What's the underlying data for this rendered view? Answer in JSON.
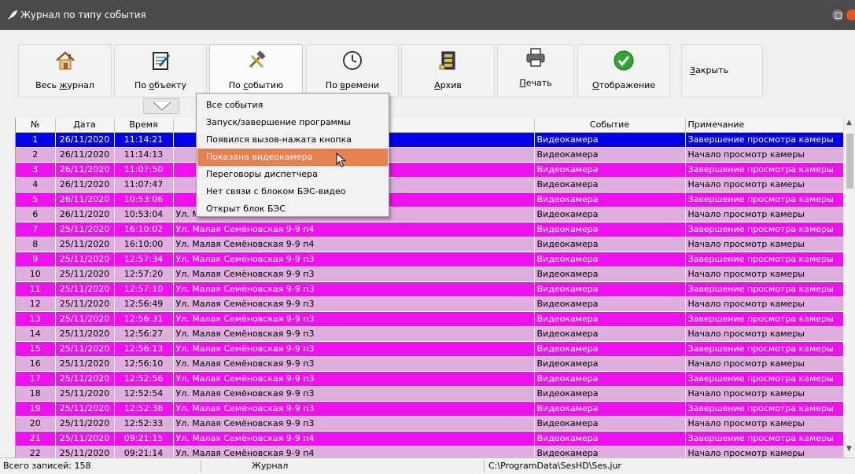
{
  "window": {
    "title": "Журнал по типу события"
  },
  "toolbar": {
    "buttons": [
      {
        "label": "Весь журнал",
        "icon": "house-icon"
      },
      {
        "label": "По объекту",
        "icon": "notepad-pencil-icon"
      },
      {
        "label": "По событию",
        "icon": "hammer-tools-icon"
      },
      {
        "label": "По времени",
        "icon": "clock-icon"
      },
      {
        "label": "Архив",
        "icon": "archive-cabinet-icon"
      },
      {
        "label": "Печать",
        "icon": "printer-icon"
      },
      {
        "label": "Отображение",
        "icon": "check-icon"
      },
      {
        "label": "Закрыть",
        "icon": ""
      }
    ]
  },
  "menu": {
    "items": [
      "Все события",
      "Запуск/завершение программы",
      "Появился вызов-нажата кнопка",
      "Показана видеокамера",
      "Переговоры диспетчера",
      "Нет связи с блоком БЭС-видео",
      "Открыт блок БЭС"
    ],
    "active_index": 3
  },
  "table": {
    "columns": [
      "№",
      "Дата",
      "Время",
      "",
      "Событие",
      "Примечание"
    ],
    "rows": [
      [
        "1",
        "26/11/2020",
        "11:14:21",
        "",
        "Видеокамера",
        "Завершение просмотра камеры"
      ],
      [
        "2",
        "26/11/2020",
        "11:14:13",
        "",
        "Видеокамера",
        "Начало просмотр камеры"
      ],
      [
        "3",
        "26/11/2020",
        "11:07:50",
        "",
        "Видеокамера",
        "Завершение просмотра камеры"
      ],
      [
        "4",
        "26/11/2020",
        "11:07:47",
        "",
        "Видеокамера",
        "Начало просмотр камеры"
      ],
      [
        "5",
        "26/11/2020",
        "10:53:06",
        "",
        "Видеокамера",
        "Завершение просмотра камеры"
      ],
      [
        "6",
        "26/11/2020",
        "10:53:04",
        "Ул. Малая Семёновская 9-9 п4",
        "Видеокамера",
        "Начало просмотр камеры"
      ],
      [
        "7",
        "25/11/2020",
        "16:10:02",
        "Ул. Малая Семёновская 9-9 п4",
        "Видеокамера",
        "Завершение просмотра камеры"
      ],
      [
        "8",
        "25/11/2020",
        "16:10:00",
        "Ул. Малая Семёновская 9-9 п4",
        "Видеокамера",
        "Начало просмотр камеры"
      ],
      [
        "9",
        "25/11/2020",
        "12:57:34",
        "Ул. Малая Семёновская 9-9 п3",
        "Видеокамера",
        "Завершение просмотра камеры"
      ],
      [
        "10",
        "25/11/2020",
        "12:57:20",
        "Ул. Малая Семёновская 9-9 п3",
        "Видеокамера",
        "Начало просмотр камеры"
      ],
      [
        "11",
        "25/11/2020",
        "12:57:10",
        "Ул. Малая Семёновская 9-9 п3",
        "Видеокамера",
        "Завершение просмотра камеры"
      ],
      [
        "12",
        "25/11/2020",
        "12:56:49",
        "Ул. Малая Семёновская 9-9 п3",
        "Видеокамера",
        "Начало просмотр камеры"
      ],
      [
        "13",
        "25/11/2020",
        "12:56:31",
        "Ул. Малая Семёновская 9-9 п3",
        "Видеокамера",
        "Завершение просмотра камеры"
      ],
      [
        "14",
        "25/11/2020",
        "12:56:27",
        "Ул. Малая Семёновская 9-9 п3",
        "Видеокамера",
        "Начало просмотр камеры"
      ],
      [
        "15",
        "25/11/2020",
        "12:56:13",
        "Ул. Малая Семёновская 9-9 п3",
        "Видеокамера",
        "Завершение просмотра камеры"
      ],
      [
        "16",
        "25/11/2020",
        "12:56:10",
        "Ул. Малая Семёновская 9-9 п3",
        "Видеокамера",
        "Начало просмотр камеры"
      ],
      [
        "17",
        "25/11/2020",
        "12:52:56",
        "Ул. Малая Семёновская 9-9 п3",
        "Видеокамера",
        "Завершение просмотра камеры"
      ],
      [
        "18",
        "25/11/2020",
        "12:52:54",
        "Ул. Малая Семёновская 9-9 п3",
        "Видеокамера",
        "Начало просмотр камеры"
      ],
      [
        "19",
        "25/11/2020",
        "12:52:38",
        "Ул. Малая Семёновская 9-9 п3",
        "Видеокамера",
        "Завершение просмотра камеры"
      ],
      [
        "20",
        "25/11/2020",
        "12:52:33",
        "Ул. Малая Семёновская 9-9 п3",
        "Видеокамера",
        "Начало просмотр камеры"
      ],
      [
        "21",
        "25/11/2020",
        "09:21:15",
        "Ул. Малая Семёновская 9-9 п4",
        "Видеокамера",
        "Завершение просмотра камеры"
      ],
      [
        "22",
        "25/11/2020",
        "09:21:14",
        "Ул. Малая Семёновская 9-9 п4",
        "Видеокамера",
        "Начало просмотр камеры"
      ]
    ],
    "selected_index": 0
  },
  "status": {
    "count": "Всего записей: 158",
    "section": "Журнал",
    "path": "C:\\ProgramData\\SesHD\\Ses.jur"
  },
  "colors": {
    "title_bar": "#4a4a4a",
    "row_odd": "#ee10ee",
    "row_even": "#dfaedf",
    "row_selected": "#0000f0",
    "menu_highlight": "#e8814f",
    "close_button": "#e95420"
  }
}
